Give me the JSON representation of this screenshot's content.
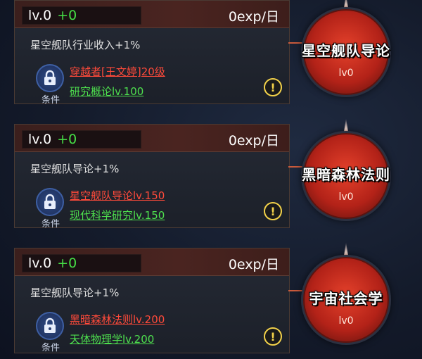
{
  "cards": [
    {
      "level": "lv.0",
      "level_gain": "+0",
      "exp": "0exp/日",
      "description": "星空舰队行业收入+1%",
      "condition_label": "条件",
      "requirement_1": "穿越者[王文婷]20级",
      "requirement_2": "研究概论lv.100",
      "node_title": "星空舰队导论",
      "node_level": "lv0"
    },
    {
      "level": "lv.0",
      "level_gain": "+0",
      "exp": "0exp/日",
      "description": "星空舰队导论+1%",
      "condition_label": "条件",
      "requirement_1": "星空舰队导论lv.150",
      "requirement_2": "现代科学研究lv.150",
      "node_title": "黑暗森林法则",
      "node_level": "lv0"
    },
    {
      "level": "lv.0",
      "level_gain": "+0",
      "exp": "0exp/日",
      "description": "星空舰队导论+1%",
      "condition_label": "条件",
      "requirement_1": "黑暗森林法则lv.200",
      "requirement_2": "天体物理学lv.200",
      "node_title": "宇宙社会学",
      "node_level": "lv0"
    }
  ],
  "icons": {
    "lock": "lock-icon",
    "info": "exclamation-icon"
  },
  "colors": {
    "level_gain": "#46e046",
    "requirement_unmet": "#ff4a3a",
    "requirement_other": "#4ee04e",
    "node_red": "#c8301f",
    "info_yellow": "#f2d14a"
  }
}
